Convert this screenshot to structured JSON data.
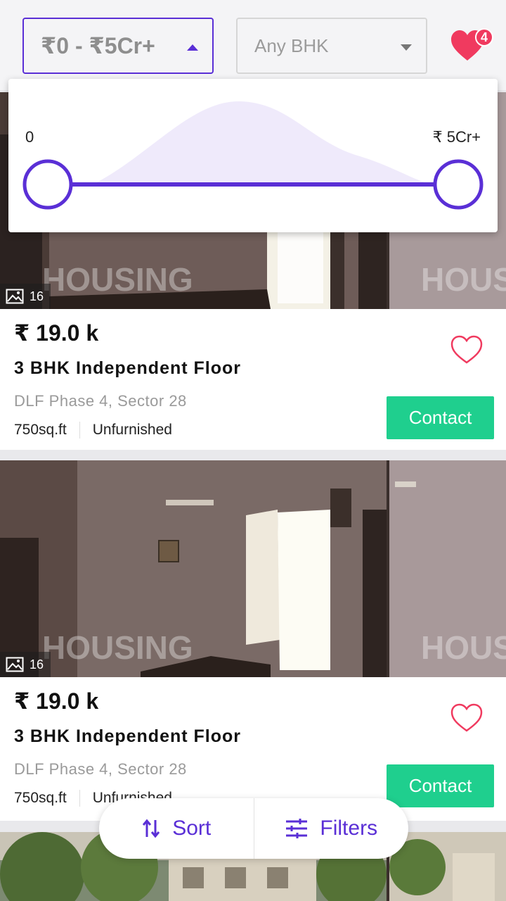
{
  "filters": {
    "price_range_label": "₹0 - ₹5Cr+",
    "bhk_label": "Any BHK",
    "favorites_count": "4"
  },
  "range_slider": {
    "min_label": "0",
    "max_label": "₹ 5Cr+",
    "selected_min_fraction": 0,
    "selected_max_fraction": 1
  },
  "listings": [
    {
      "photo_count": "16",
      "watermark": "HOUSING",
      "price": "₹ 19.0 k",
      "title": "3 BHK Independent Floor",
      "location": "DLF Phase 4, Sector 28",
      "area": "750sq.ft",
      "furnishing": "Unfurnished",
      "contact_label": "Contact"
    },
    {
      "photo_count": "16",
      "watermark": "HOUSING",
      "price": "₹ 19.0 k",
      "title": "3 BHK Independent Floor",
      "location": "DLF Phase 4, Sector 28",
      "area": "750sq.ft",
      "furnishing": "Unfurnished",
      "contact_label": "Contact"
    }
  ],
  "bottom_actions": {
    "sort_label": "Sort",
    "filters_label": "Filters"
  },
  "colors": {
    "accent": "#5a2fd6",
    "contact": "#1fcf8e",
    "heart": "#f03a5f"
  }
}
